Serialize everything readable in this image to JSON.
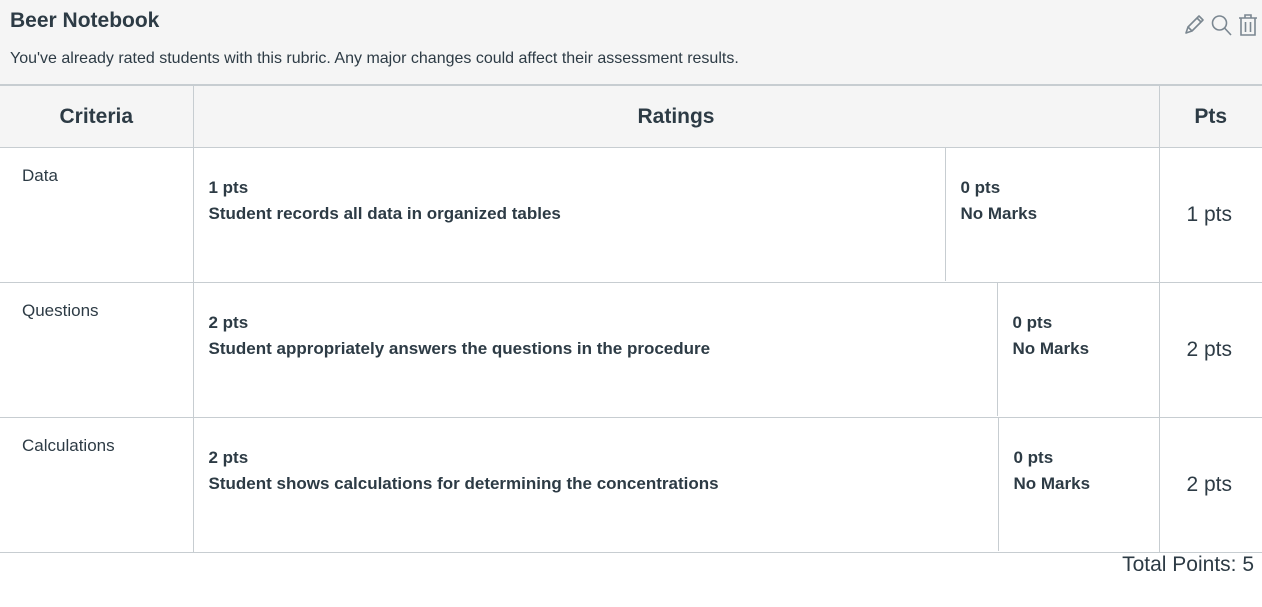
{
  "rubric": {
    "title": "Beer Notebook",
    "notice": "You've already rated students with this rubric. Any major changes could affect their assessment results.",
    "icons": [
      "edit-pencil-icon",
      "search-icon",
      "trash-icon"
    ]
  },
  "columns": {
    "criteria": "Criteria",
    "ratings": "Ratings",
    "pts": "Pts"
  },
  "criteria": [
    {
      "name": "Data",
      "ratings": [
        {
          "pts": "1 pts",
          "description": "Student records all data in organized tables"
        },
        {
          "pts": "0 pts",
          "description": "No Marks"
        }
      ],
      "points": "1 pts"
    },
    {
      "name": "Questions",
      "ratings": [
        {
          "pts": "2 pts",
          "description": "Student appropriately answers the questions in the procedure"
        },
        {
          "pts": "0 pts",
          "description": "No Marks"
        }
      ],
      "points": "2 pts"
    },
    {
      "name": "Calculations",
      "ratings": [
        {
          "pts": "2 pts",
          "description": "Student shows calculations for determining the concentrations"
        },
        {
          "pts": "0 pts",
          "description": "No Marks"
        }
      ],
      "points": "2 pts"
    }
  ],
  "total": "Total Points: 5"
}
